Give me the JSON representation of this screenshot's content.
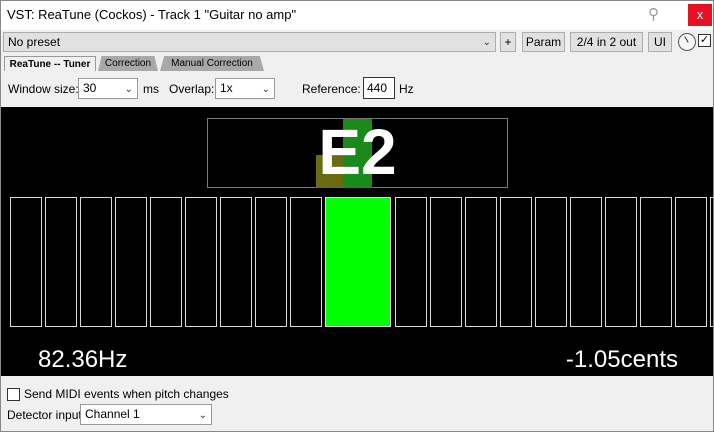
{
  "window": {
    "title": "VST: ReaTune (Cockos) - Track 1 \"Guitar no amp\"",
    "pin_icon": "pin-icon",
    "close_label": "x"
  },
  "toolbar": {
    "preset": "No preset",
    "plus_label": "+",
    "param_label": "Param",
    "io_label": "2/4 in 2 out",
    "ui_label": "UI",
    "enabled_mark": "✓"
  },
  "tabs": [
    {
      "label": "ReaTune -- Tuner",
      "active": true
    },
    {
      "label": "Correction",
      "active": false
    },
    {
      "label": "Manual Correction",
      "active": false
    }
  ],
  "settings": {
    "window_size_label": "Window size:",
    "window_size_value": "30",
    "window_size_unit": "ms",
    "overlap_label": "Overlap:",
    "overlap_value": "1x",
    "reference_label": "Reference:",
    "reference_value": "440",
    "reference_unit": "Hz"
  },
  "tuner": {
    "note": "E2",
    "frequency": "82.36Hz",
    "cents": "-1.05cents",
    "meter_cells": 20,
    "active_cell": 9,
    "colors": {
      "active": "#00ff00",
      "bar_flat": "#6a6a10",
      "bar_center": "#1a8a1a"
    }
  },
  "bottom": {
    "midi_label": "Send MIDI events when pitch changes",
    "midi_checked": false,
    "detector_label": "Detector input:",
    "detector_value": "Channel 1"
  }
}
